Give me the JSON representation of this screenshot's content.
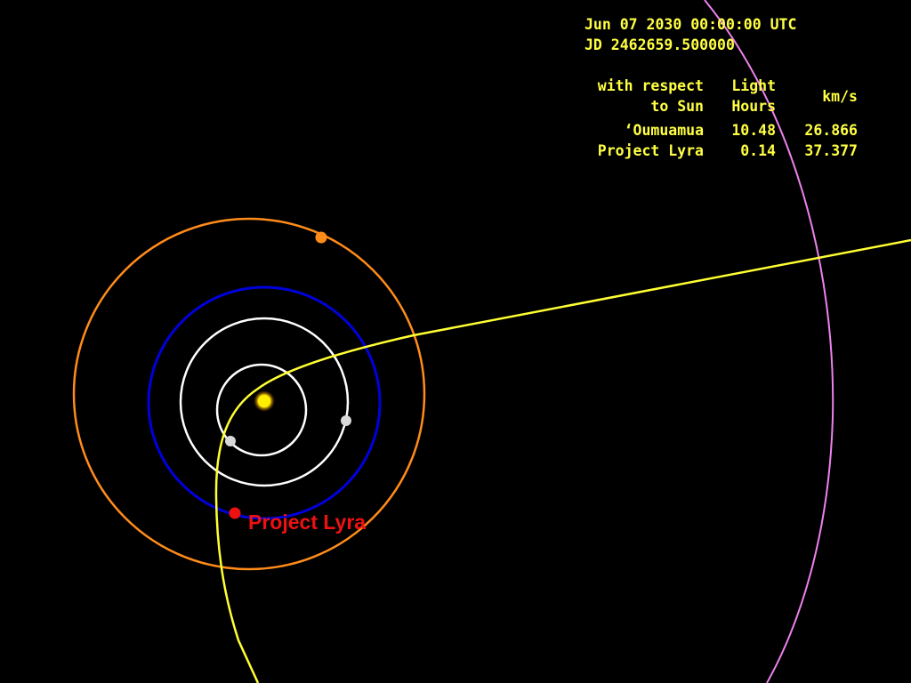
{
  "header": {
    "date": "Jun 07 2030 00:00:00 UTC",
    "jd": "JD 2462659.500000"
  },
  "table": {
    "headers": {
      "name": "with respect\nto Sun",
      "light_hours": "Light\nHours",
      "kms": "km/s"
    },
    "rows": [
      {
        "name": "‘Oumuamua",
        "light_hours": "10.48",
        "kms": "26.866"
      },
      {
        "name": "Project Lyra",
        "light_hours": "0.14",
        "kms": "37.377"
      }
    ]
  },
  "labels": {
    "spacecraft": "Project Lyra"
  },
  "colors": {
    "background": "#000000",
    "hud_text": "#ffff44",
    "sun": "#ffee00",
    "mercury_orbit": "#ffffff",
    "venus_orbit": "#ffffff",
    "earth_orbit": "#0000dd",
    "mars_orbit": "#ff8c1a",
    "oumuamua_orbit": "#ee82ee",
    "lyra_trajectory": "#ffff33",
    "lyra_label": "#ee1111"
  },
  "bodies": [
    {
      "name": "sun",
      "icon": "sun-icon"
    },
    {
      "name": "mercury",
      "icon": "planet-icon"
    },
    {
      "name": "venus",
      "icon": "planet-icon"
    },
    {
      "name": "earth",
      "icon": "planet-icon"
    },
    {
      "name": "mars",
      "icon": "planet-icon"
    },
    {
      "name": "project-lyra",
      "icon": "spacecraft-icon"
    }
  ]
}
